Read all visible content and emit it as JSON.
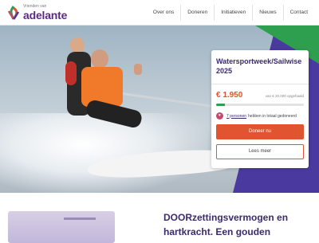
{
  "brand": {
    "small": "Vrienden van",
    "name": "adelante"
  },
  "nav": {
    "items": [
      "Over ons",
      "Doneren",
      "Initiatieven",
      "Nieuws",
      "Contact"
    ]
  },
  "campaign": {
    "title": "Watersportweek/Sailwise 2025",
    "amount": "€ 1.950",
    "goal": "van € 20.000 opgehaald",
    "progress": 0.0975,
    "donors_link": "7 personen",
    "donors_text": "hebben in totaal gedoneerd",
    "donate_button": "Doneer nu",
    "more_button": "Lees meer"
  },
  "headline": "DOORzettingsvermogen en hartkracht. Een gouden",
  "colors": {
    "accent": "#e05530",
    "brand_purple": "#3a2a6e",
    "progress_green": "#2e9e4f"
  }
}
